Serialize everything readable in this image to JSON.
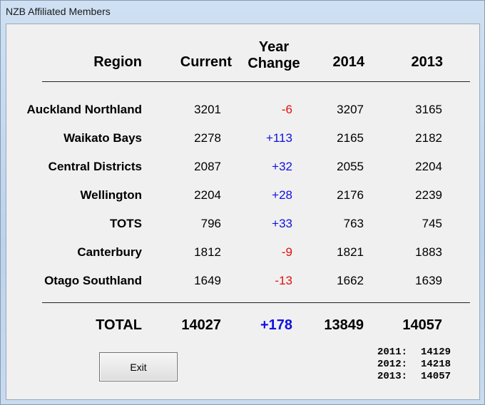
{
  "window": {
    "title": "NZB Affiliated Members"
  },
  "headers": {
    "region": "Region",
    "current": "Current",
    "year_change_line1": "Year",
    "year_change_line2": "Change",
    "y2014": "2014",
    "y2013": "2013"
  },
  "rows": [
    {
      "region": "Auckland Northland",
      "current": "3201",
      "change": "-6",
      "y2014": "3207",
      "y2013": "3165"
    },
    {
      "region": "Waikato Bays",
      "current": "2278",
      "change": "+113",
      "y2014": "2165",
      "y2013": "2182"
    },
    {
      "region": "Central Districts",
      "current": "2087",
      "change": "+32",
      "y2014": "2055",
      "y2013": "2204"
    },
    {
      "region": "Wellington",
      "current": "2204",
      "change": "+28",
      "y2014": "2176",
      "y2013": "2239"
    },
    {
      "region": "TOTS",
      "current": "796",
      "change": "+33",
      "y2014": "763",
      "y2013": "745"
    },
    {
      "region": "Canterbury",
      "current": "1812",
      "change": "-9",
      "y2014": "1821",
      "y2013": "1883"
    },
    {
      "region": "Otago Southland",
      "current": "1649",
      "change": "-13",
      "y2014": "1662",
      "y2013": "1639"
    }
  ],
  "total": {
    "label": "TOTAL",
    "current": "14027",
    "change": "+178",
    "y2014": "13849",
    "y2013": "14057"
  },
  "exit_button": {
    "label": "Exit"
  },
  "history": [
    {
      "year": "2011:",
      "value": "14129"
    },
    {
      "year": "2012:",
      "value": "14218"
    },
    {
      "year": "2013:",
      "value": "14057"
    }
  ],
  "colors": {
    "negative": "#e01010",
    "positive": "#1010e0"
  }
}
